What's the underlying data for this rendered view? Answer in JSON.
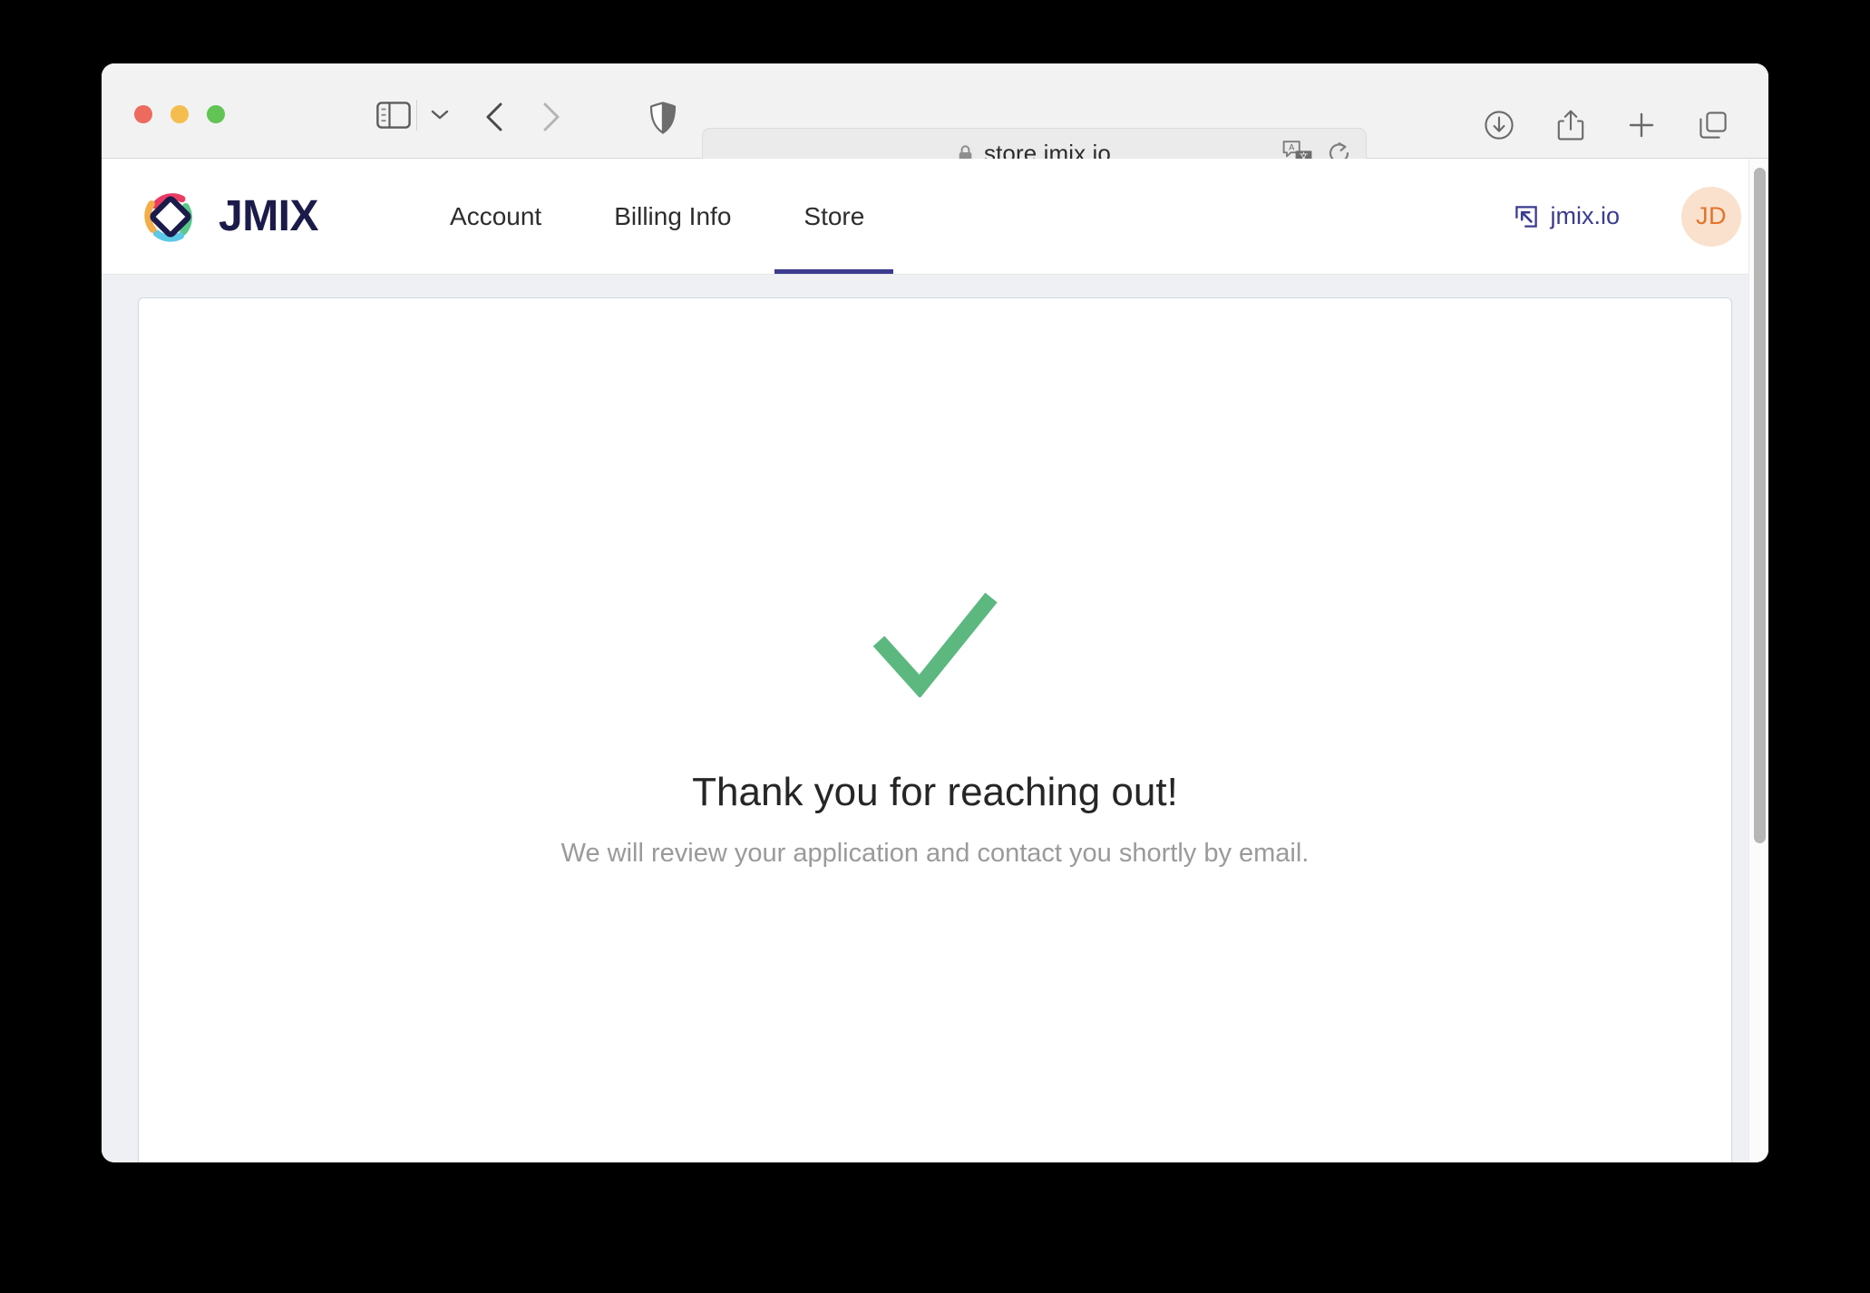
{
  "browser": {
    "app": "Safari",
    "traffic_lights": [
      {
        "name": "close",
        "color": "#ed6a5e"
      },
      {
        "name": "minimize",
        "color": "#f5bd4f"
      },
      {
        "name": "zoom",
        "color": "#61c454"
      }
    ],
    "toolbar_icons": [
      "sidebar-icon",
      "chevron-down-icon",
      "back-arrow-icon",
      "forward-arrow-icon",
      "privacy-shield-icon"
    ],
    "url_bar": {
      "url": "store.jmix.io",
      "lock_icon": "lock-icon",
      "translate_icon": "translate-icon",
      "reload_icon": "reload-icon"
    },
    "right_icons": [
      "downloads-icon",
      "share-icon",
      "new-tab-icon",
      "tab-overview-icon"
    ]
  },
  "site": {
    "brand": {
      "wordmark": "JMIX",
      "logo_icon": "jmix-diamond-logo",
      "colors": {
        "navy": "#1b1b4b",
        "pink": "#ec3b62",
        "green": "#57c98a",
        "cyan": "#5cc8e8",
        "orange": "#f3ae49"
      }
    },
    "nav": {
      "tabs": [
        {
          "label": "Account",
          "active": false
        },
        {
          "label": "Billing Info",
          "active": false
        },
        {
          "label": "Store",
          "active": true
        }
      ],
      "active_underline_color": "#3b3b8f"
    },
    "header_right": {
      "external_link_label": "jmix.io",
      "external_link_icon": "external-link-icon",
      "avatar_initials": "JD",
      "avatar_bg": "#fae1cd",
      "avatar_fg": "#e3742c"
    }
  },
  "main": {
    "success": {
      "icon": "green-checkmark-icon",
      "icon_color": "#5cb87f",
      "title": "Thank you for reaching out!",
      "subtitle": "We will review your application and contact you shortly by email."
    }
  }
}
